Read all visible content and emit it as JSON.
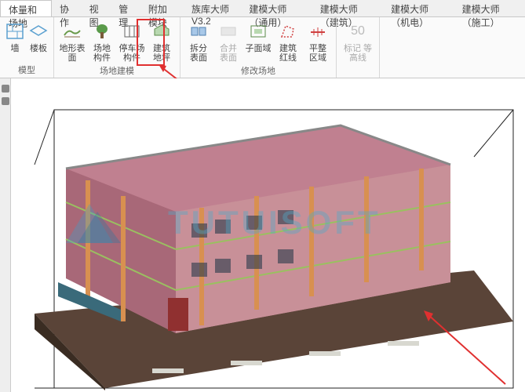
{
  "tabs": [
    {
      "label": "体量和场地",
      "active": true
    },
    {
      "label": "协作"
    },
    {
      "label": "视图"
    },
    {
      "label": "管理"
    },
    {
      "label": "附加模块"
    },
    {
      "label": "族库大师V3.2"
    },
    {
      "label": "建模大师（通用）"
    },
    {
      "label": "建模大师（建筑）"
    },
    {
      "label": "建模大师（机电）"
    },
    {
      "label": "建模大师（施工）"
    }
  ],
  "ribbon": {
    "groups": [
      {
        "name": "模型",
        "items": [
          {
            "label": "墙",
            "icon": "wall"
          },
          {
            "label": "楼板",
            "icon": "floor"
          }
        ]
      },
      {
        "name": "场地建模",
        "items": [
          {
            "label": "地形表面",
            "icon": "terrain"
          },
          {
            "label": "场地\n构件",
            "icon": "site-comp"
          },
          {
            "label": "停车场\n构件",
            "icon": "parking"
          },
          {
            "label": "建筑\n地坪",
            "icon": "building-pad",
            "highlighted": true
          }
        ]
      },
      {
        "name": "修改场地",
        "items": [
          {
            "label": "拆分\n表面",
            "icon": "split"
          },
          {
            "label": "合并\n表面",
            "icon": "merge",
            "disabled": true
          },
          {
            "label": "子面域",
            "icon": "subregion"
          },
          {
            "label": "建筑\n红线",
            "icon": "redline"
          },
          {
            "label": "平整\n区域",
            "icon": "graded"
          }
        ]
      },
      {
        "name": "",
        "items": [
          {
            "label": "标记\n等高线",
            "icon": "label-contour",
            "disabled": true,
            "value": "50"
          }
        ]
      }
    ]
  },
  "watermark": {
    "text": "TUTUISOFT"
  },
  "colors": {
    "building_wall": "#c08090",
    "building_accent": "#d89050",
    "ground": "#5a4438",
    "highlight": "#e03030",
    "watermark": "rgba(80,170,200,0.4)"
  }
}
